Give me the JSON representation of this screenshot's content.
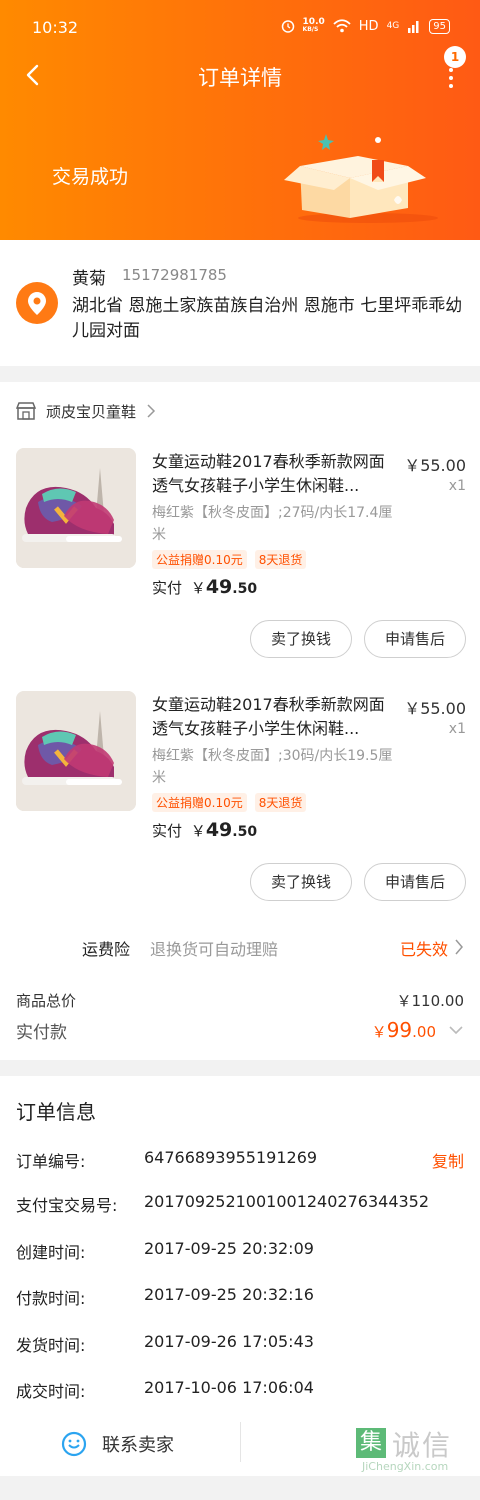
{
  "status_bar": {
    "time": "10:32",
    "speed": "10.0",
    "speed_unit": "KB/S",
    "hd": "HD",
    "signal": "4G",
    "battery": "95"
  },
  "nav": {
    "title": "订单详情",
    "badge_count": "1"
  },
  "header": {
    "trade_status": "交易成功"
  },
  "address": {
    "name": "黄菊",
    "phone": "15172981785",
    "detail": "湖北省 恩施土家族苗族自治州 恩施市 七里坪乖乖幼儿园对面"
  },
  "shop": {
    "name": "顽皮宝贝童鞋"
  },
  "goods": [
    {
      "title": "女童运动鞋2017春秋季新款网面透气女孩鞋子小学生休闲鞋...",
      "price": "￥55.00",
      "qty": "x1",
      "sku": "梅红紫【秋冬皮面】;27码/内长17.4厘米",
      "tag1": "公益捐赠0.10元",
      "tag2": "8天退货",
      "paid_label": "实付",
      "paid_currency": "￥",
      "paid_int": "49",
      "paid_dec": ".50",
      "btn_sell": "卖了换钱",
      "btn_after": "申请售后"
    },
    {
      "title": "女童运动鞋2017春秋季新款网面透气女孩鞋子小学生休闲鞋...",
      "price": "￥55.00",
      "qty": "x1",
      "sku": "梅红紫【秋冬皮面】;30码/内长19.5厘米",
      "tag1": "公益捐赠0.10元",
      "tag2": "8天退货",
      "paid_label": "实付",
      "paid_currency": "￥",
      "paid_int": "49",
      "paid_dec": ".50",
      "btn_sell": "卖了换钱",
      "btn_after": "申请售后"
    }
  ],
  "insurance": {
    "label": "运费险",
    "desc": "退换货可自动理赔",
    "status": "已失效"
  },
  "summary": {
    "total_label": "商品总价",
    "total_value": "￥110.00",
    "paid_label": "实付款",
    "paid_currency": "￥",
    "paid_int": "99",
    "paid_dec": ".00"
  },
  "order_info": {
    "title": "订单信息",
    "rows": [
      {
        "key": "订单编号:",
        "value": "64766893955191269",
        "action": "复制"
      },
      {
        "key": "支付宝交易号:",
        "value": "2017092521001001240276344352"
      },
      {
        "key": "创建时间:",
        "value": "2017-09-25 20:32:09"
      },
      {
        "key": "付款时间:",
        "value": "2017-09-25 20:32:16"
      },
      {
        "key": "发货时间:",
        "value": "2017-09-26 17:05:43"
      },
      {
        "key": "成交时间:",
        "value": "2017-10-06 17:06:04"
      }
    ],
    "contact_label": "联系卖家"
  },
  "watermark": {
    "box": "集",
    "text": "诚信",
    "sub": "JiChengXin.com"
  },
  "colors": {
    "accent": "#ff5000",
    "header_start": "#ff8a00",
    "header_end": "#ff5a14"
  }
}
